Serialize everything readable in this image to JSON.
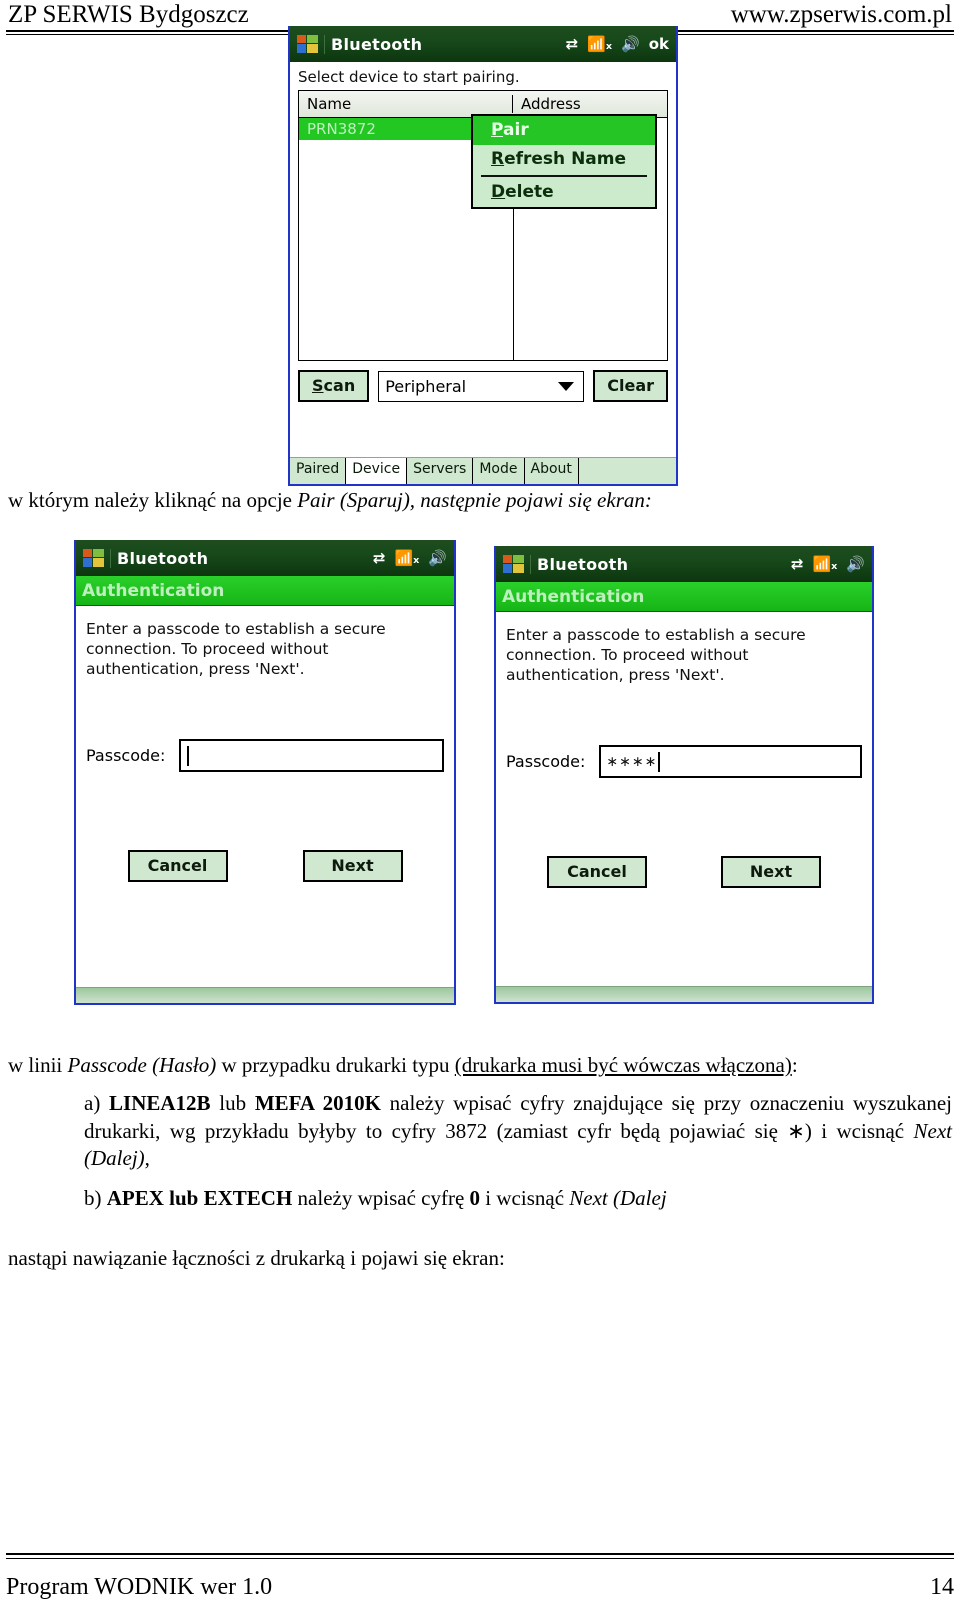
{
  "header": {
    "company": "ZP SERWIS Bydgoszcz",
    "website": "www.zpserwis.com.pl"
  },
  "screenshot_pairing": {
    "titlebar": {
      "title": "Bluetooth",
      "ok_label": "ok",
      "icons": [
        "connectivity-icon",
        "signal-off-icon",
        "speaker-icon"
      ]
    },
    "hint": "Select device to start pairing.",
    "table": {
      "columns": [
        "Name",
        "Address"
      ],
      "rows": [
        {
          "name": "PRN3872",
          "address": ""
        }
      ]
    },
    "context_menu": [
      {
        "label": "Pair",
        "accel": "P",
        "selected": true
      },
      {
        "label": "Refresh Name",
        "accel": "R",
        "selected": false
      },
      {
        "label": "Delete",
        "accel": "D",
        "selected": false
      }
    ],
    "controls": {
      "scan_label": "Scan",
      "scan_accel": "S",
      "mode_value": "Peripheral",
      "clear_label": "Clear"
    },
    "tabs": [
      {
        "label": "Paired",
        "active": false
      },
      {
        "label": "Device",
        "active": true
      },
      {
        "label": "Servers",
        "active": false
      },
      {
        "label": "Mode",
        "active": false
      },
      {
        "label": "About",
        "active": false
      }
    ]
  },
  "screenshot_auth_empty": {
    "titlebar": {
      "title": "Bluetooth"
    },
    "band_title": "Authentication",
    "instructions": "Enter a passcode to establish a secure connection. To proceed without authentication, press 'Next'.",
    "passcode_label": "Passcode:",
    "passcode_value": "",
    "buttons": {
      "cancel": "Cancel",
      "next": "Next"
    }
  },
  "screenshot_auth_filled": {
    "titlebar": {
      "title": "Bluetooth"
    },
    "band_title": "Authentication",
    "instructions": "Enter a passcode to establish a secure connection. To proceed without authentication, press 'Next'.",
    "passcode_label": "Passcode:",
    "passcode_value": "∗∗∗∗",
    "buttons": {
      "cancel": "Cancel",
      "next": "Next"
    }
  },
  "body": {
    "p1_pre": "w którym należy kliknąć na opcje ",
    "p1_it": "Pair (Sparuj), następnie pojawi się ekran:",
    "p2_pre": "w linii ",
    "p2_it": "Passcode (Hasło)",
    "p2_mid": " w przypadku drukarki typu ",
    "p2_u": "(drukarka musi być wówczas włączona)",
    "p2_end": ":",
    "p3_marker": "a) ",
    "p3_b1": "LINEA12B",
    "p3_t1": " lub ",
    "p3_b2": "MEFA 2010K",
    "p3_t2": " należy wpisać cyfry znajdujące się przy oznaczeniu wyszukanej drukarki, wg przykładu byłyby to cyfry 3872 (zamiast cyfr będą pojawiać się ∗) i wcisnąć ",
    "p3_it": "Next (Dalej)",
    "p3_end": ",",
    "p4_marker": "b) ",
    "p4_b1": "APEX lub EXTECH",
    "p4_t1": " należy wpisać cyfrę ",
    "p4_b2": "0",
    "p4_t2": " i wcisnąć ",
    "p4_it": "Next (Dalej",
    "p5": "nastąpi nawiązanie łączności z drukarką i pojawi się ekran:"
  },
  "footer": {
    "program": "Program WODNIK wer 1.0",
    "page": "14"
  },
  "colors": {
    "titlebar_green": "#17491a",
    "band_green": "#1fc41f",
    "selection_green": "#22c722",
    "device_border_blue": "#2035c8",
    "button_face": "#cfe8cf"
  }
}
